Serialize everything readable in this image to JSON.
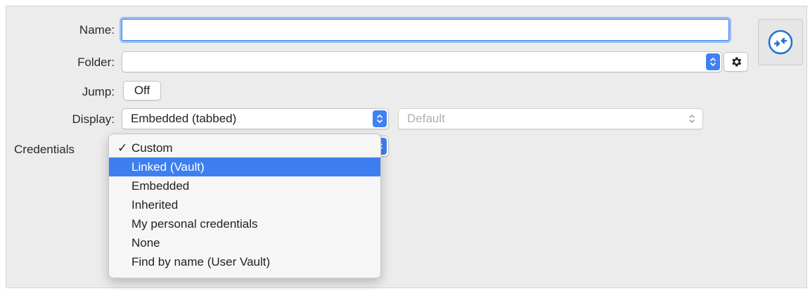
{
  "form": {
    "name_label": "Name:",
    "name_value": "",
    "folder_label": "Folder:",
    "folder_value": "",
    "jump_label": "Jump:",
    "jump_button": "Off",
    "display_label": "Display:",
    "display_value": "Embedded (tabbed)",
    "display_secondary_value": "Default",
    "credentials_label": "Credentials"
  },
  "icons": {
    "folder_settings": "gear-icon",
    "entry_type": "remote-desktop-icon",
    "popup_arrows": "chevron-up-down-icon"
  },
  "credentials_menu": {
    "selected": "Custom",
    "highlighted": "Linked (Vault)",
    "items": [
      {
        "label": "Custom",
        "checked": true
      },
      {
        "label": "Linked (Vault)",
        "highlighted": true
      },
      {
        "label": "Embedded"
      },
      {
        "label": "Inherited"
      },
      {
        "label": "My personal credentials"
      },
      {
        "label": "None"
      },
      {
        "label": "Find by name (User Vault)"
      }
    ]
  },
  "colors": {
    "accent": "#3d7ff0",
    "focus_ring": "#5a96f0",
    "panel": "#ececec"
  }
}
